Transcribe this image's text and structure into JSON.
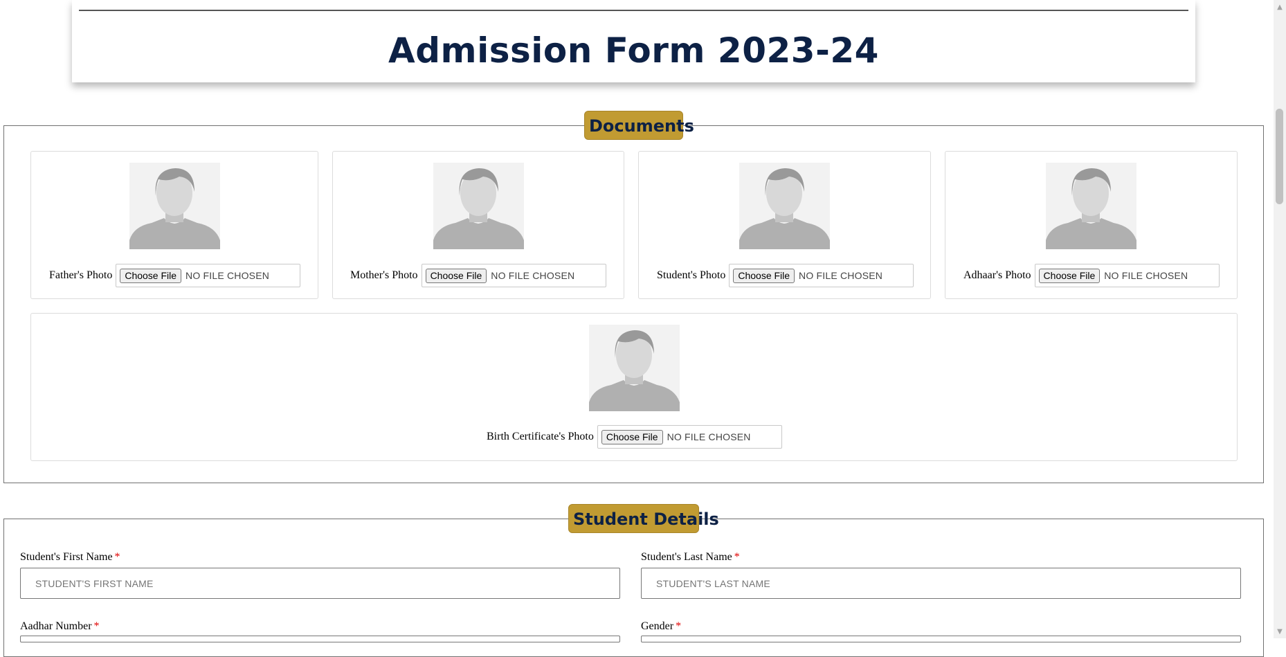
{
  "header": {
    "title": "Admission Form 2023-24"
  },
  "documents": {
    "legend": "Documents",
    "cards": [
      {
        "label": "Father's Photo",
        "button": "Choose File",
        "status": "NO FILE CHOSEN",
        "avatar_icon": "person-placeholder-icon"
      },
      {
        "label": "Mother's Photo",
        "button": "Choose File",
        "status": "NO FILE CHOSEN",
        "avatar_icon": "person-placeholder-icon"
      },
      {
        "label": "Student's Photo",
        "button": "Choose File",
        "status": "NO FILE CHOSEN",
        "avatar_icon": "person-placeholder-icon"
      },
      {
        "label": "Adhaar's Photo",
        "button": "Choose File",
        "status": "NO FILE CHOSEN",
        "avatar_icon": "person-placeholder-icon"
      },
      {
        "label": "Birth Certificate's Photo",
        "button": "Choose File",
        "status": "NO FILE CHOSEN",
        "avatar_icon": "person-placeholder-icon"
      }
    ]
  },
  "student_details": {
    "legend": "Student Details",
    "required_marker": "*",
    "fields": {
      "first_name": {
        "label": "Student's First Name",
        "placeholder": "STUDENT'S FIRST NAME",
        "value": ""
      },
      "last_name": {
        "label": "Student's Last Name",
        "placeholder": "STUDENT'S LAST NAME",
        "value": ""
      },
      "aadhar": {
        "label": "Aadhar Number"
      },
      "gender": {
        "label": "Gender"
      }
    }
  },
  "colors": {
    "title": "#0d2145",
    "legend_bg": "#c19b32",
    "required": "#e00000"
  },
  "scrollbar": {
    "up_icon": "scroll-up-arrow-icon",
    "down_icon": "scroll-down-arrow-icon"
  }
}
